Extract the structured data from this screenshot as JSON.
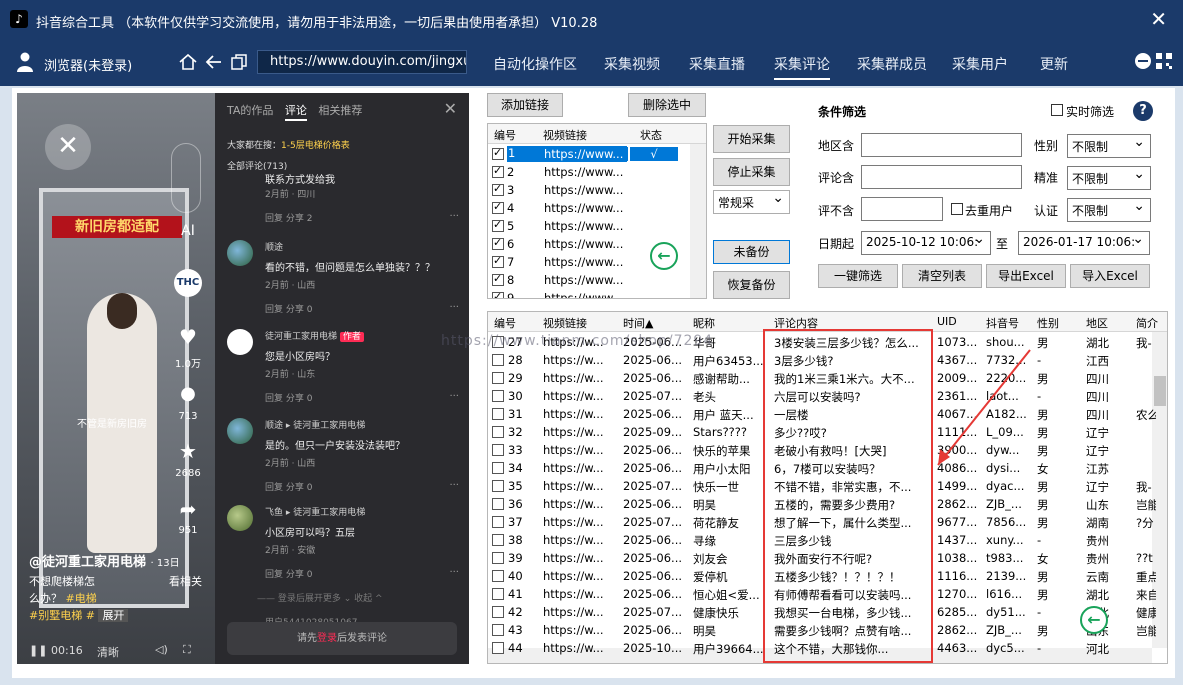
{
  "window": {
    "title": "抖音综合工具 （本软件仅供学习交流使用，请勿用于非法用途，一切后果由使用者承担）  V10.28",
    "logo": "♪",
    "close": "✕"
  },
  "toolbar": {
    "browser_label": "浏览器(未登录)",
    "url": "https://www.douyin.com/jingxuan",
    "tabs": [
      "自动化操作区",
      "采集视频",
      "采集直播",
      "采集评论",
      "采集群成员",
      "采集用户",
      "更新"
    ],
    "active_tab": "采集评论",
    "icons": [
      "home-icon",
      "back-icon",
      "copy-icon"
    ]
  },
  "video": {
    "banner": "新旧房都适配",
    "caption": "不管是新房旧房",
    "author": "@徒河重工家用电梯",
    "date": "· 13日",
    "desc1": "不想爬楼梯怎",
    "desc2": "么办？",
    "hashtag1": "#电梯",
    "hashtag2": "#别墅电梯",
    "hashtag3": "#",
    "expand": "展开",
    "related": "看相关",
    "likes": "1.0万",
    "comments": "713",
    "favorites": "2686",
    "shares": "951",
    "time": "00:16",
    "quality": "清晰",
    "ai": "AI"
  },
  "comments_panel": {
    "tabs": [
      "TA的作品",
      "评论",
      "相关推荐"
    ],
    "active": "评论",
    "search_prefix": "大家都在搜：",
    "search_term": "1-5层电梯价格表",
    "all_count": "全部评论(713)",
    "first_partial": "联系方式发给我",
    "first_meta": "2月前 · 四川",
    "first_actions": "回复   分享   2   ",
    "items": [
      {
        "name": "顺途",
        "text": "看的不错，但问题是怎么单独装？？？",
        "meta": "2月前 · 山西",
        "actions": "回复   分享   0   "
      },
      {
        "name": "徒河重工家用电梯",
        "tag": "作者",
        "text": "您是小区房吗？",
        "meta": "2月前 · 山东",
        "actions": "回复   分享   0   "
      },
      {
        "name": "顺途 ▸ 徒河重工家用电梯",
        "text": "是的。但只一户安装没法装吧？",
        "meta": "2月前 · 山西",
        "actions": "回复   分享   0   "
      },
      {
        "name": "飞鱼 ▸ 徒河重工家用电梯",
        "text": "小区房可以吗？五层",
        "meta": "2月前 · 安徽",
        "actions": "回复   分享   0   "
      }
    ],
    "login_hint": "—— 登录后展开更多 ⌄    收起 ^",
    "bottom_partial": "用户5441028051067",
    "post_prefix": "请先",
    "post_link": "登录",
    "post_suffix": "后发表评论"
  },
  "links": {
    "add_button": "添加链接",
    "delete_button": "删除选中",
    "headers": [
      "编号",
      "视频链接",
      "状态"
    ],
    "rows": [
      {
        "id": "1",
        "url": "https://www...",
        "status": "√",
        "selected": true
      },
      {
        "id": "2",
        "url": "https://www...",
        "status": ""
      },
      {
        "id": "3",
        "url": "https://www...",
        "status": ""
      },
      {
        "id": "4",
        "url": "https://www...",
        "status": ""
      },
      {
        "id": "5",
        "url": "https://www...",
        "status": ""
      },
      {
        "id": "6",
        "url": "https://www...",
        "status": ""
      },
      {
        "id": "7",
        "url": "https://www...",
        "status": ""
      },
      {
        "id": "8",
        "url": "https://www...",
        "status": ""
      },
      {
        "id": "9",
        "url": "https://www...",
        "status": ""
      }
    ]
  },
  "actions": {
    "start": "开始采集",
    "stop": "停止采集",
    "mode": "常规采",
    "backup": "未备份",
    "restore": "恢复备份"
  },
  "filter": {
    "title": "条件筛选",
    "realtime": "实时筛选",
    "help": "?",
    "region_label": "地区含",
    "comment_label": "评论含",
    "exclude_label": "评不含",
    "dedup_label": "去重用户",
    "gender_label": "性别",
    "gender_value": "不限制",
    "precise_label": "精准",
    "precise_value": "不限制",
    "auth_label": "认证",
    "auth_value": "不限制",
    "date_label": "日期起",
    "date_from": "2025-10-12 10:06:",
    "date_to_label": "至",
    "date_to": "2026-01-17 10:06:",
    "buttons": [
      "一键筛选",
      "清空列表",
      "导出Excel",
      "导入Excel"
    ]
  },
  "results": {
    "headers": [
      "编号",
      "视频链接",
      "时间▲",
      "昵称",
      "评论内容",
      "UID",
      "抖音号",
      "性别",
      "地区",
      "简介"
    ],
    "rows": [
      [
        "27",
        "https://w...",
        "2025-06...",
        "华哥",
        "3楼安装三层多少钱？怎么...",
        "1073...",
        "shou...",
        "男",
        "湖北",
        "我-"
      ],
      [
        "28",
        "https://w...",
        "2025-06...",
        "用户63453...",
        "3层多少钱?",
        "4367...",
        "7732...",
        "-",
        "江西",
        ""
      ],
      [
        "29",
        "https://w...",
        "2025-06...",
        "感谢帮助...",
        "我的1米三乘1米六。大不...",
        "2009...",
        "2220...",
        "男",
        "四川",
        ""
      ],
      [
        "30",
        "https://w...",
        "2025-07...",
        "老头",
        "六层可以安装吗?",
        "2361...",
        "laot...",
        "-",
        "四川",
        ""
      ],
      [
        "31",
        "https://w...",
        "2025-06...",
        "用户 蓝天...",
        "一层楼",
        "4067...",
        "A182...",
        "男",
        "四川",
        "农么"
      ],
      [
        "32",
        "https://w...",
        "2025-09...",
        "Stars????",
        "多少??哎?",
        "1111...",
        "L_09...",
        "男",
        "辽宁",
        ""
      ],
      [
        "33",
        "https://w...",
        "2025-06...",
        "快乐的苹果",
        "老破小有救吗！[大哭]",
        "3900...",
        "dyw...",
        "男",
        "辽宁",
        ""
      ],
      [
        "34",
        "https://w...",
        "2025-06...",
        "用户小太阳",
        "6，7楼可以安装吗？",
        "4086...",
        "dysi...",
        "女",
        "江苏",
        ""
      ],
      [
        "35",
        "https://w...",
        "2025-07...",
        "快乐一世",
        "不错不错，非常实惠，不...",
        "1499...",
        "dyac...",
        "男",
        "辽宁",
        "我-"
      ],
      [
        "36",
        "https://w...",
        "2025-06...",
        "明昊",
        "五楼的，需要多少费用?",
        "2862...",
        "ZJB_...",
        "男",
        "山东",
        "岂能"
      ],
      [
        "37",
        "https://w...",
        "2025-07...",
        "荷花静友",
        "想了解一下，属什么类型...",
        "9677...",
        "7856...",
        "男",
        "湖南",
        "?分"
      ],
      [
        "38",
        "https://w...",
        "2025-06...",
        "寻缘",
        "三层多少钱",
        "1437...",
        "xuny...",
        "-",
        "贵州",
        ""
      ],
      [
        "39",
        "https://w...",
        "2025-06...",
        "刘友会",
        "我外面安行不行呢?",
        "1038...",
        "t983...",
        "女",
        "贵州",
        "??t"
      ],
      [
        "40",
        "https://w...",
        "2025-06...",
        "爱停机",
        "五楼多少钱？！？！？！",
        "1116...",
        "2139...",
        "男",
        "云南",
        "重点"
      ],
      [
        "41",
        "https://w...",
        "2025-06...",
        "恒心姐<爱...",
        "有师傅帮看看可以安装吗...",
        "1270...",
        "l616...",
        "男",
        "湖北",
        "来自"
      ],
      [
        "42",
        "https://w...",
        "2025-07...",
        "健康快乐",
        "我想买一台电梯，多少钱...",
        "6285...",
        "dy51...",
        "-",
        "湖北",
        "健康"
      ],
      [
        "43",
        "https://w...",
        "2025-06...",
        "明昊",
        "需要多少钱啊？点赞有啥...",
        "2862...",
        "ZJB_...",
        "男",
        "山东",
        "岂能"
      ],
      [
        "44",
        "https://w...",
        "2025-10...",
        "用户39664...",
        "这个不错，大那钱你...",
        "4463...",
        "dyc5...",
        "-",
        "河北",
        ""
      ]
    ]
  },
  "watermark": "https://www.tianm.com/shop/7294"
}
